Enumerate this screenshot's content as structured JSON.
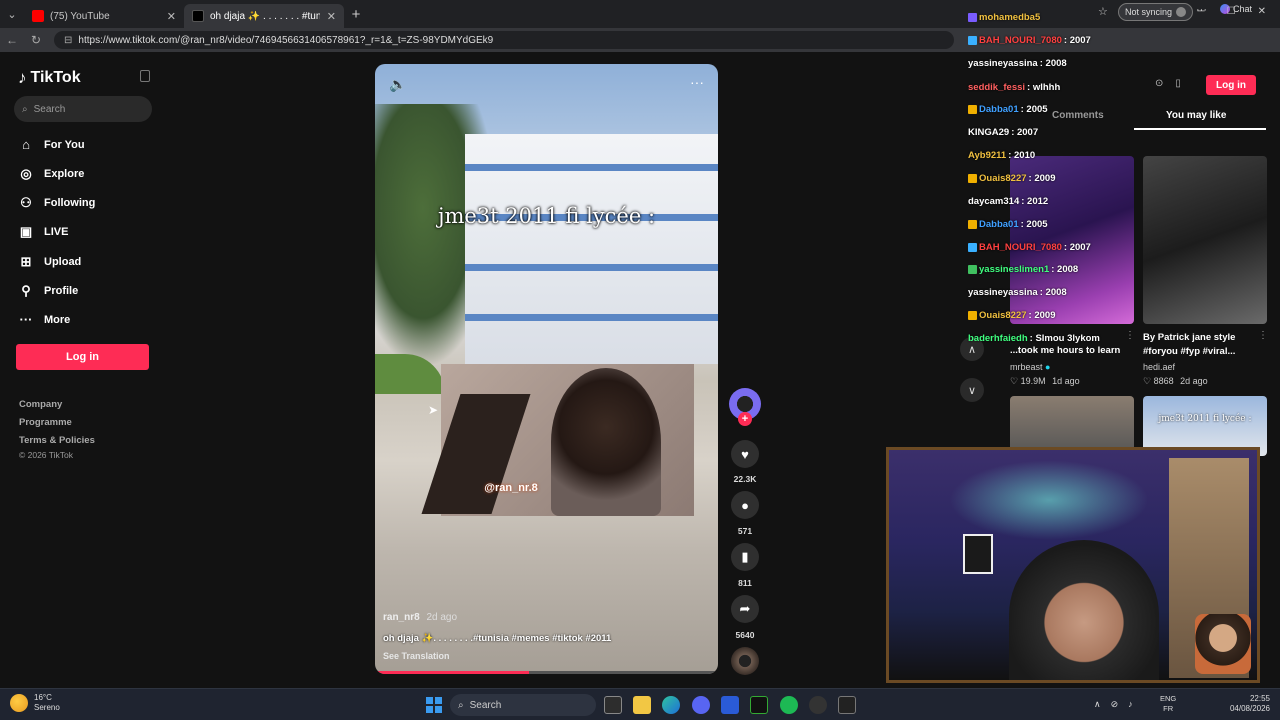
{
  "browser": {
    "tabs": [
      {
        "label": "(75) YouTube",
        "favicon_color": "#ff0000"
      },
      {
        "label": "oh djaja ✨ . . . . . . . #tunisia #memes",
        "favicon_color": "#000000"
      }
    ],
    "url": "https://www.tiktok.com/@ran_nr8/video/7469456631406578961?_r=1&_t=ZS-98YDMYdGEk9",
    "sync_label": "Not syncing",
    "chat_label": "Chat"
  },
  "sidebar": {
    "brand": "TikTok",
    "search_placeholder": "Search",
    "nav": [
      {
        "label": "For You",
        "icon": "home-icon"
      },
      {
        "label": "Explore",
        "icon": "compass-icon"
      },
      {
        "label": "Following",
        "icon": "user-icon"
      },
      {
        "label": "LIVE",
        "icon": "live-icon"
      },
      {
        "label": "Upload",
        "icon": "plus-square-icon"
      },
      {
        "label": "Profile",
        "icon": "profile-icon"
      },
      {
        "label": "More",
        "icon": "more-dots-icon"
      }
    ],
    "login": "Log in",
    "footer": [
      "Company",
      "Programme",
      "Terms & Policies"
    ],
    "copyright": "© 2026 TikTok"
  },
  "video": {
    "overlay_text": "jme3t 2011 fi lycée :",
    "watermark": "@ran_nr.8",
    "author": "ran_nr8",
    "date": "2d ago",
    "caption": "oh djaja ✨. . . . . . . .#tunisia #memes #tiktok #2011",
    "see_translation": "See Translation",
    "progress": 0.45
  },
  "actions": {
    "likes": "22.3K",
    "comments": "571",
    "saves": "811",
    "shares": "5640"
  },
  "right_panel": {
    "login": "Log in",
    "tabs": [
      "Comments",
      "You may like"
    ],
    "active_tab": "You may like",
    "cards": [
      {
        "title": "...took me hours to learn",
        "author": "mrbeast",
        "views": "19.9M",
        "date": "1d ago"
      },
      {
        "title": "By Patrick jane style #foryou #fyp #viral...",
        "author": "hedi.aef",
        "views": "8868",
        "date": "2d ago"
      }
    ],
    "thumb4_text": "jme3t 2011 fi lycée :"
  },
  "stream_chat": [
    {
      "user": "mohamedba5",
      "msg": "",
      "color": "#f0c040",
      "badge": "#7a5cff"
    },
    {
      "user": "BAH_NOURI_7080",
      "msg": ": 2007",
      "color": "#ff4040",
      "badge": "#3ab0ff"
    },
    {
      "user": "yassineyassina",
      "msg": ": 2008",
      "color": "#ffffff",
      "badge": ""
    },
    {
      "user": "seddik_fessi",
      "msg": ": wlhhh",
      "color": "#ff6060",
      "badge": ""
    },
    {
      "user": "Dabba01",
      "msg": ": 2005",
      "color": "#40a0ff",
      "badge": "#f0b000"
    },
    {
      "user": "KINGA29",
      "msg": ": 2007",
      "color": "#ffffff",
      "badge": ""
    },
    {
      "user": "Ayb9211",
      "msg": ": 2010",
      "color": "#f0c040",
      "badge": ""
    },
    {
      "user": "Ouais8227",
      "msg": ": 2009",
      "color": "#f0c040",
      "badge": "#f0b000"
    },
    {
      "user": "daycam314",
      "msg": ": 2012",
      "color": "#ffffff",
      "badge": ""
    },
    {
      "user": "Dabba01",
      "msg": ": 2005",
      "color": "#40a0ff",
      "badge": "#f0b000"
    },
    {
      "user": "BAH_NOURI_7080",
      "msg": ": 2007",
      "color": "#ff4040",
      "badge": "#3ab0ff"
    },
    {
      "user": "yassineslimen1",
      "msg": ": 2008",
      "color": "#40ff80",
      "badge": "#40c060"
    },
    {
      "user": "yassineyassina",
      "msg": ": 2008",
      "color": "#ffffff",
      "badge": ""
    },
    {
      "user": "Ouais8227",
      "msg": ": 2009",
      "color": "#f0c040",
      "badge": "#f0b000"
    },
    {
      "user": "baderhfaiedh",
      "msg": ": Slmou 3lykom",
      "color": "#40ff80",
      "badge": ""
    }
  ],
  "taskbar": {
    "weather_temp": "16°C",
    "weather_desc": "Sereno",
    "search": "Search",
    "lang1": "ENG",
    "lang2": "FR",
    "time": "22:55",
    "date": "04/08/2026"
  }
}
